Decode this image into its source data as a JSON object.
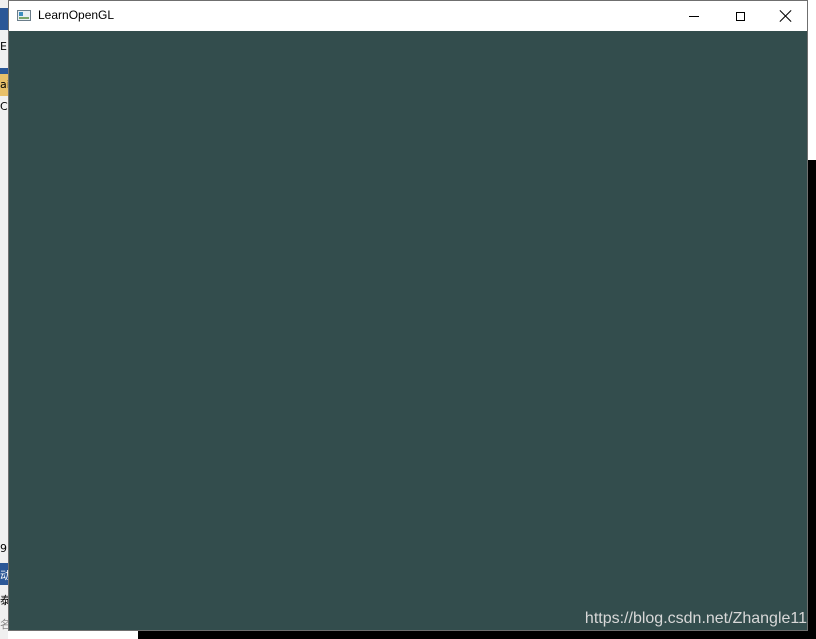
{
  "window": {
    "title": "LearnOpenGL",
    "clear_color": "#334d4d"
  },
  "controls": {
    "minimize_icon": "minimize-icon",
    "maximize_icon": "maximize-icon",
    "close_icon": "close-icon"
  },
  "watermark": {
    "text": "https://blog.csdn.net/Zhangle11"
  },
  "background_fragments": {
    "f1": "E",
    "f2": "ai",
    "f3": "C",
    "f4": "9",
    "f5": "动",
    "f6": "泰",
    "f7": "名"
  }
}
